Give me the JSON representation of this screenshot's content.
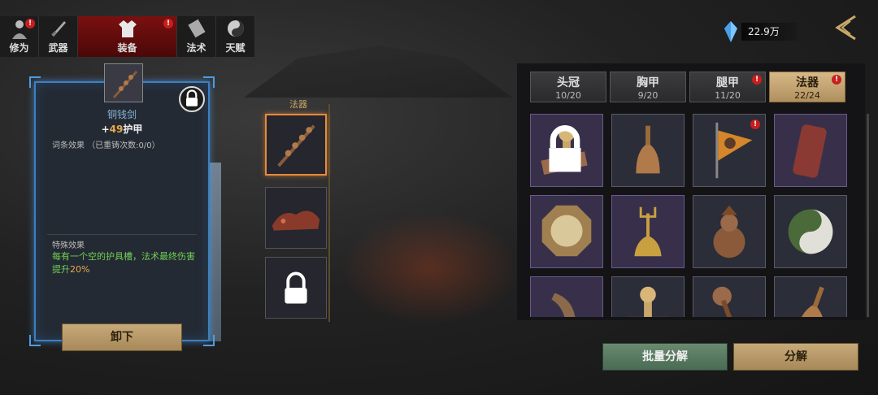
{
  "nav": {
    "tabs": [
      {
        "label": "修为",
        "icon": "character-icon",
        "badge": "!"
      },
      {
        "label": "武器",
        "icon": "weapon-icon",
        "badge": ""
      },
      {
        "label": "装备",
        "icon": "robe-icon",
        "badge": "!"
      },
      {
        "label": "法术",
        "icon": "scroll-icon",
        "badge": ""
      },
      {
        "label": "天赋",
        "icon": "taiji-icon",
        "badge": ""
      }
    ],
    "active": "装备"
  },
  "currency": {
    "value": "22.9万",
    "icon": "spirit-crystal-icon"
  },
  "item_card": {
    "name": "铜钱剑",
    "stat_prefix": "+",
    "stat_value": "49",
    "stat_name": "护甲",
    "affix_label": "词条效果",
    "affix_note": "（已重铸次数:0/0）",
    "special_title": "特殊效果",
    "special_text": "每有一个空的护具槽，法术最终伤害提升",
    "special_pct": "20%",
    "unequip_label": "卸下",
    "border_color": "#3d7fc0"
  },
  "slots": {
    "title": "法器",
    "items": [
      {
        "name": "copper-coin-sword",
        "selected": true
      },
      {
        "name": "dragon-carving",
        "selected": false
      },
      {
        "name": "locked-slot",
        "selected": false
      }
    ]
  },
  "inventory": {
    "tabs": [
      {
        "label": "头冠",
        "count": "10/20",
        "badge": ""
      },
      {
        "label": "胸甲",
        "count": "9/20",
        "badge": ""
      },
      {
        "label": "腿甲",
        "count": "11/20",
        "badge": "!"
      },
      {
        "label": "法器",
        "count": "22/24",
        "badge": "!"
      }
    ],
    "active_tab": "法器",
    "items": [
      {
        "name": "seal-stamp-icon",
        "rarity": "purple",
        "locked": true,
        "badge": ""
      },
      {
        "name": "bell-icon",
        "rarity": "blue",
        "locked": false,
        "badge": ""
      },
      {
        "name": "bagua-flag-icon",
        "rarity": "blue",
        "locked": false,
        "badge": "!"
      },
      {
        "name": "red-token-icon",
        "rarity": "purple",
        "locked": false,
        "badge": ""
      },
      {
        "name": "bagua-mirror-icon",
        "rarity": "purple",
        "locked": false,
        "badge": ""
      },
      {
        "name": "trident-bell-icon",
        "rarity": "purple",
        "locked": false,
        "badge": ""
      },
      {
        "name": "gourd-censer-icon",
        "rarity": "blue",
        "locked": false,
        "badge": ""
      },
      {
        "name": "yinyang-stone-icon",
        "rarity": "blue",
        "locked": false,
        "badge": ""
      },
      {
        "name": "horn-icon",
        "rarity": "purple",
        "locked": false,
        "badge": ""
      },
      {
        "name": "seal-stamp-icon",
        "rarity": "blue",
        "locked": false,
        "badge": ""
      },
      {
        "name": "mallet-icon",
        "rarity": "blue",
        "locked": false,
        "badge": ""
      },
      {
        "name": "bell-icon",
        "rarity": "blue",
        "locked": false,
        "badge": ""
      }
    ]
  },
  "actions": {
    "batch_label": "批量分解",
    "decompose_label": "分解"
  }
}
